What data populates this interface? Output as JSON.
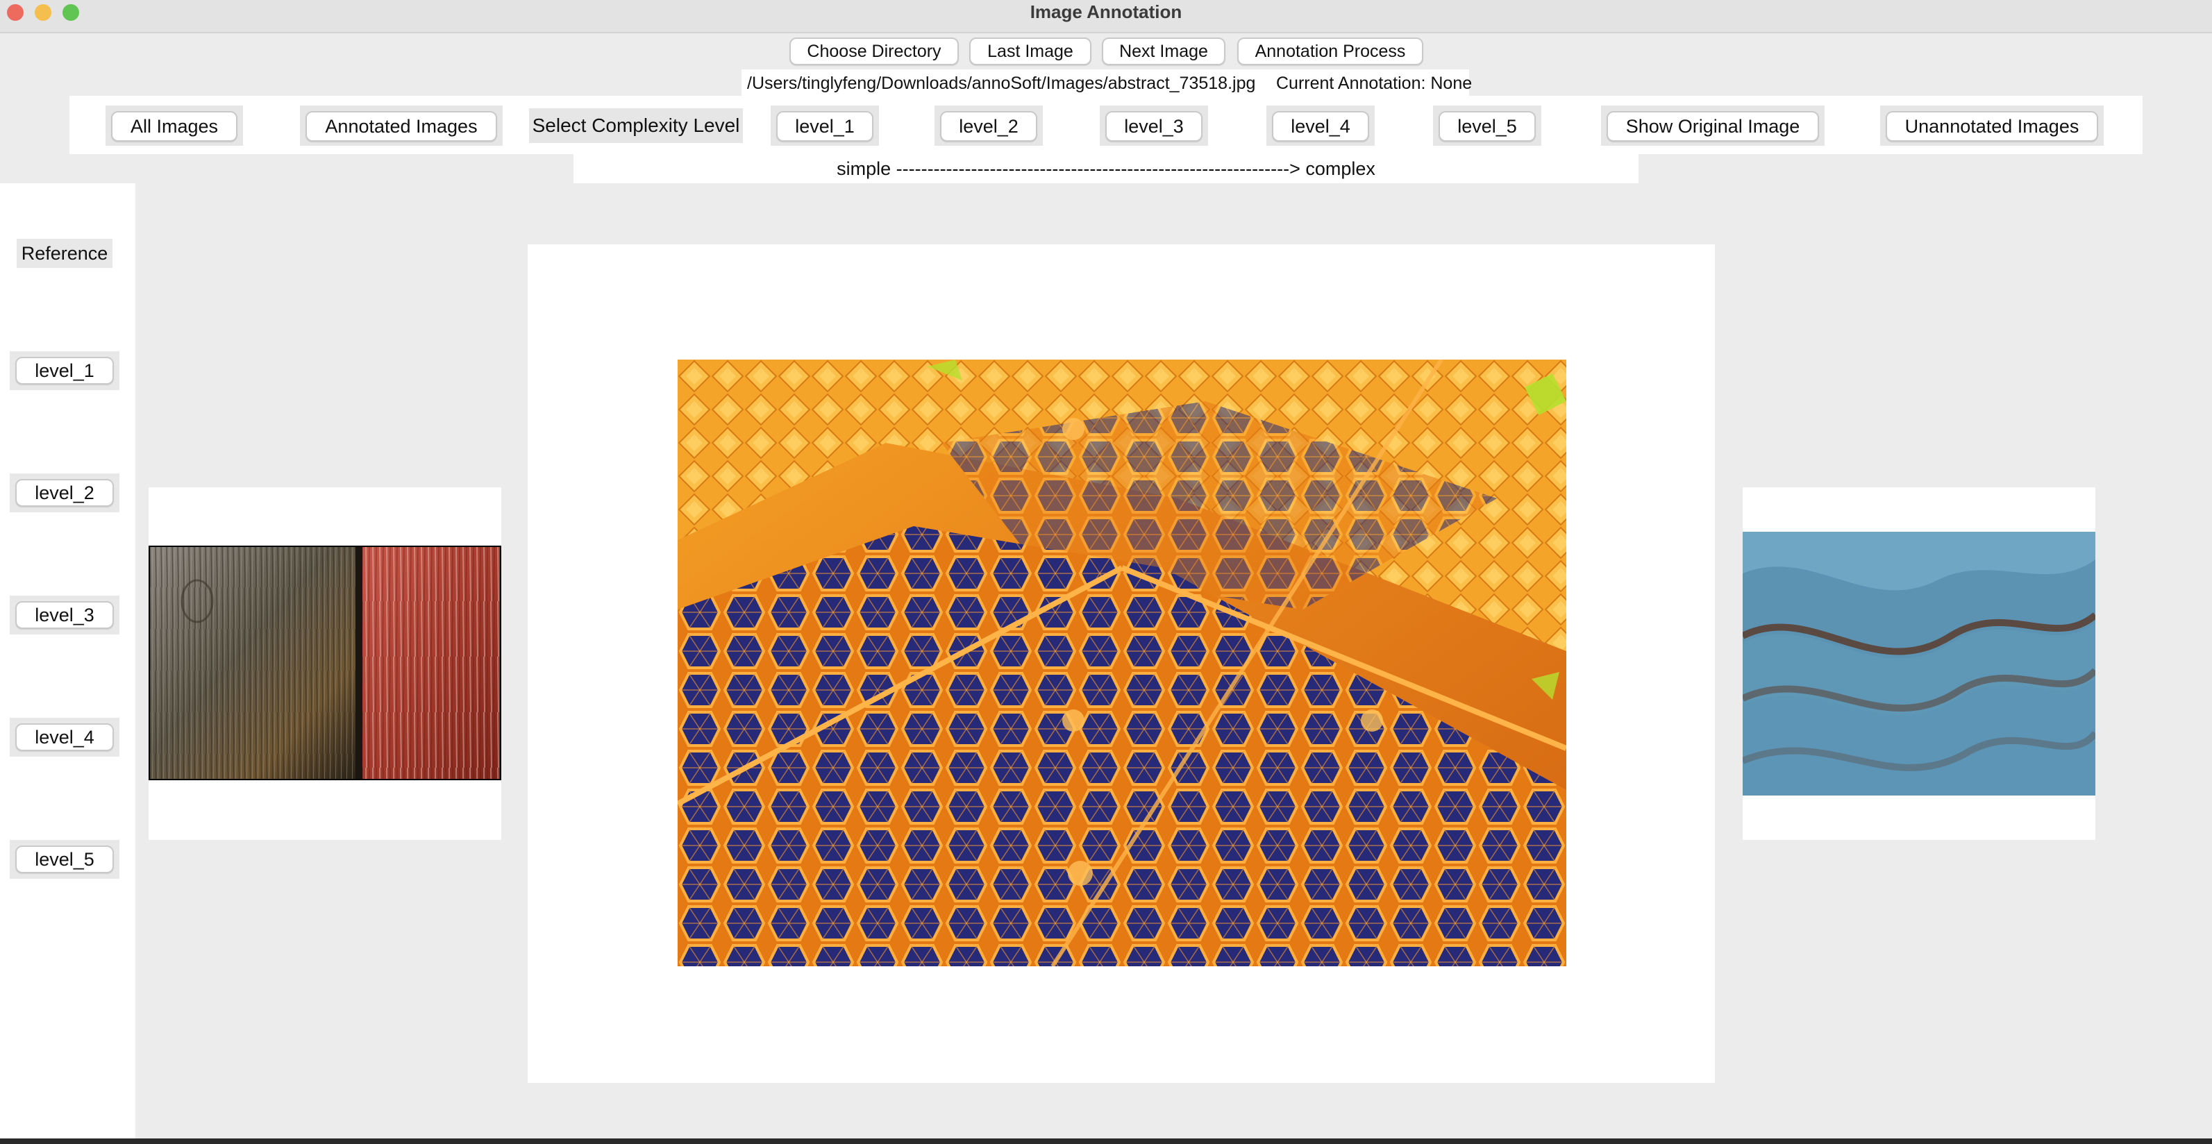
{
  "window": {
    "title": "Image Annotation",
    "colors": {
      "close": "#ed6a5e",
      "minimize": "#f5bf4f",
      "zoom": "#61c554"
    }
  },
  "toolbar": {
    "choose_directory": "Choose Directory",
    "last_image": "Last Image",
    "next_image": "Next Image",
    "annotation_process": "Annotation Process"
  },
  "status": {
    "path": "/Users/tinglyfeng/Downloads/annoSoft/Images/abstract_73518.jpg",
    "current_annotation": "Current Annotation: None"
  },
  "filters": {
    "all_images": "All Images",
    "annotated_images": "Annotated Images",
    "select_complexity_level": "Select Complexity Level",
    "levels": [
      "level_1",
      "level_2",
      "level_3",
      "level_4",
      "level_5"
    ],
    "show_original_image": "Show Original Image",
    "unannotated_images": "Unannotated Images"
  },
  "scale": {
    "caption": "simple ---------------------------------------------------------------> complex"
  },
  "reference": {
    "label": "Reference",
    "levels": [
      "level_1",
      "level_2",
      "level_3",
      "level_4",
      "level_5"
    ]
  },
  "images": {
    "left_reference": "wood-and-rust-texture",
    "main": "orange-reflector-hexagon-pattern",
    "right_reference": "blue-wave-steps"
  }
}
